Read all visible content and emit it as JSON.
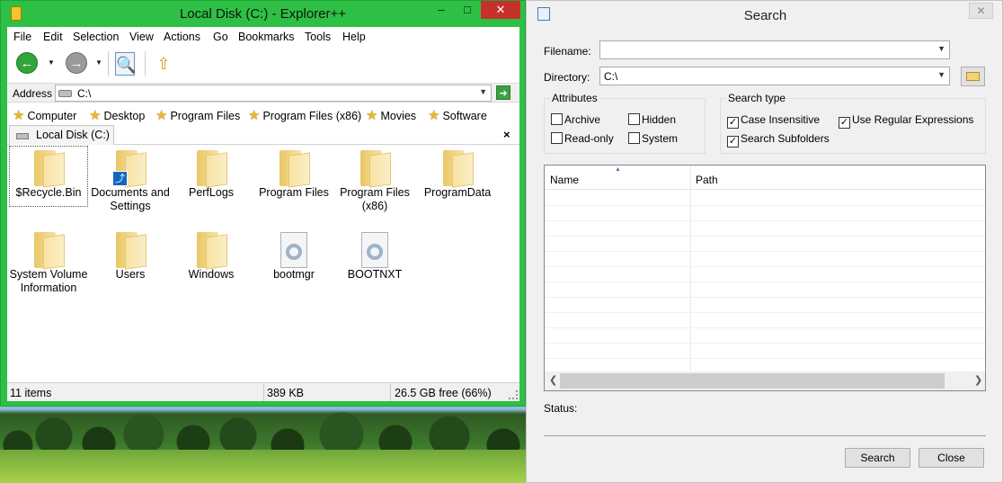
{
  "explorer": {
    "title": "Local Disk (C:) - Explorer++",
    "window_controls": {
      "minimize": "–",
      "maximize": "□",
      "close": "✕"
    },
    "menu": [
      "File",
      "Edit",
      "Selection",
      "View",
      "Actions",
      "Go",
      "Bookmarks",
      "Tools",
      "Help"
    ],
    "address": {
      "label": "Address",
      "value": "C:\\"
    },
    "bookmarks": [
      "Computer",
      "Desktop",
      "Program Files",
      "Program Files (x86)",
      "Movies",
      "Software"
    ],
    "tab": {
      "label": "Local Disk (C:)",
      "close": "×"
    },
    "files": [
      {
        "name": "$Recycle.Bin",
        "icon": "folder-icon",
        "selected": true
      },
      {
        "name": "Documents and Settings",
        "icon": "folder-shortcut-icon"
      },
      {
        "name": "PerfLogs",
        "icon": "folder-icon"
      },
      {
        "name": "Program Files",
        "icon": "folder-icon"
      },
      {
        "name": "Program Files (x86)",
        "icon": "folder-icon"
      },
      {
        "name": "ProgramData",
        "icon": "folder-icon"
      },
      {
        "name": "System Volume Information",
        "icon": "folder-icon"
      },
      {
        "name": "Users",
        "icon": "folder-icon"
      },
      {
        "name": "Windows",
        "icon": "folder-icon"
      },
      {
        "name": "bootmgr",
        "icon": "system-file-icon"
      },
      {
        "name": "BOOTNXT",
        "icon": "system-file-icon"
      }
    ],
    "status": {
      "items": "11 items",
      "size": "389 KB",
      "free": "26.5 GB free (66%)"
    }
  },
  "search": {
    "title": "Search",
    "close": "✕",
    "filename_label": "Filename:",
    "filename_value": "",
    "directory_label": "Directory:",
    "directory_value": "C:\\",
    "attributes": {
      "title": "Attributes",
      "archive": {
        "label": "Archive",
        "checked": false
      },
      "hidden": {
        "label": "Hidden",
        "checked": false
      },
      "readonly": {
        "label": "Read-only",
        "checked": false
      },
      "system": {
        "label": "System",
        "checked": false
      }
    },
    "search_type": {
      "title": "Search type",
      "case_insensitive": {
        "label": "Case Insensitive",
        "checked": true
      },
      "regex": {
        "label": "Use Regular Expressions",
        "checked": true
      },
      "subfolders": {
        "label": "Search Subfolders",
        "checked": true
      }
    },
    "columns": [
      "Name",
      "Path"
    ],
    "status_label": "Status:",
    "buttons": {
      "search": "Search",
      "close": "Close"
    }
  },
  "colors": {
    "explorer_frame": "#2ec045",
    "close_button": "#c7312b",
    "dialog_bg": "#f0f0f0"
  }
}
